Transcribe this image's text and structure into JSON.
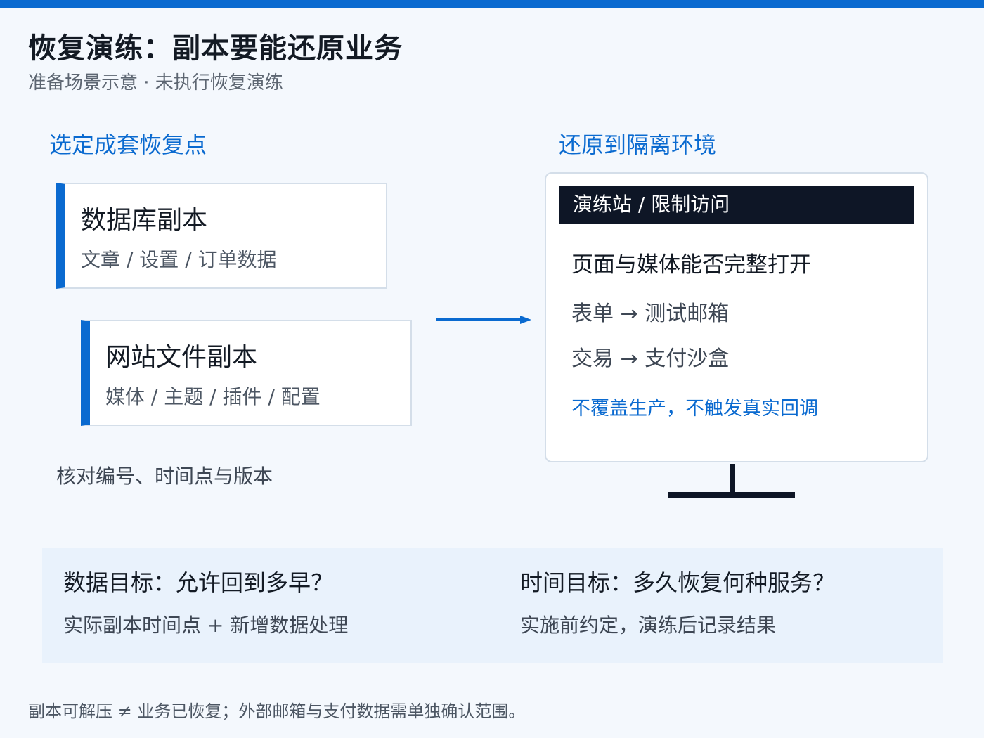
{
  "header": {
    "title": "恢复演练：副本要能还原业务",
    "subtitle": "准备场景示意 · 未执行恢复演练"
  },
  "left_section": {
    "heading": "选定成套恢复点",
    "cards": [
      {
        "title": "数据库副本",
        "description": "文章 / 设置 / 订单数据"
      },
      {
        "title": "网站文件副本",
        "description": "媒体 / 主题 / 插件 / 配置"
      }
    ],
    "note": "核对编号、时间点与版本"
  },
  "right_section": {
    "heading": "还原到隔离环境",
    "monitor": {
      "bar_label": "演练站 / 限制访问",
      "check_title": "页面与媒体能否完整打开",
      "lines": [
        "表单 → 测试邮箱",
        "交易 → 支付沙盒"
      ],
      "note": "不覆盖生产，不触发真实回调"
    }
  },
  "goals": {
    "data_goal": {
      "title": "数据目标：允许回到多早？",
      "description": "实际副本时间点 + 新增数据处理"
    },
    "time_goal": {
      "title": "时间目标：多久恢复何种服务？",
      "description": "实施前约定，演练后记录结果"
    }
  },
  "footer": {
    "note": "副本可解压 ≠ 业务已恢复；外部邮箱与支付数据需单独确认范围。"
  },
  "colors": {
    "accent": "#0a6ad0",
    "dark": "#0e1626",
    "background": "#f4f8fd",
    "panel": "#e9f2fc"
  }
}
